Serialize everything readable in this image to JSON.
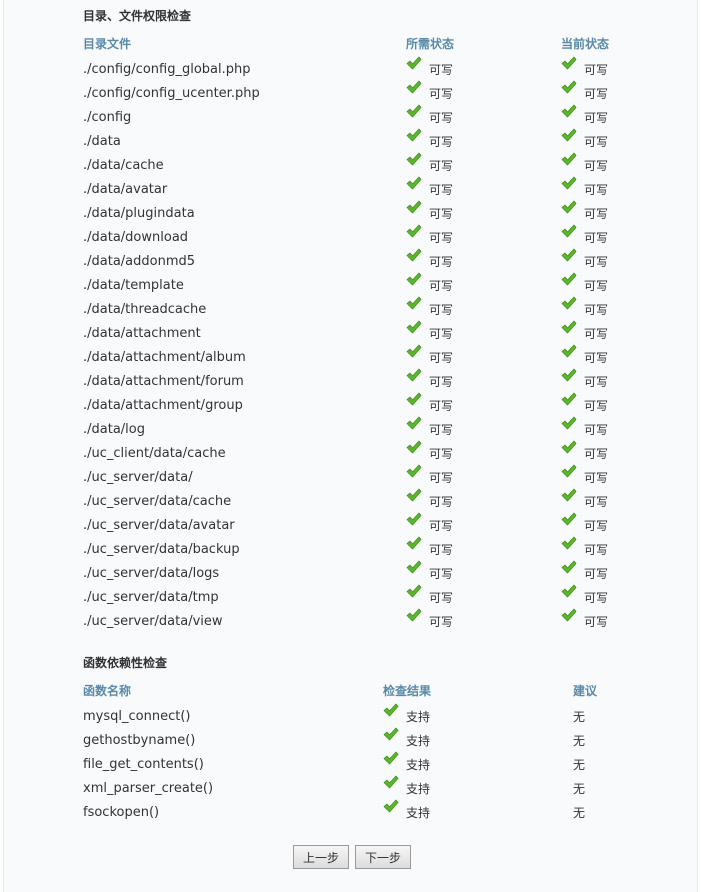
{
  "dir_check": {
    "title": "目录、文件权限检查",
    "headers": {
      "path": "目录文件",
      "required": "所需状态",
      "current": "当前状态"
    },
    "rows": [
      {
        "path": "./config/config_global.php",
        "required": "可写",
        "current": "可写"
      },
      {
        "path": "./config/config_ucenter.php",
        "required": "可写",
        "current": "可写"
      },
      {
        "path": "./config",
        "required": "可写",
        "current": "可写"
      },
      {
        "path": "./data",
        "required": "可写",
        "current": "可写"
      },
      {
        "path": "./data/cache",
        "required": "可写",
        "current": "可写"
      },
      {
        "path": "./data/avatar",
        "required": "可写",
        "current": "可写"
      },
      {
        "path": "./data/plugindata",
        "required": "可写",
        "current": "可写"
      },
      {
        "path": "./data/download",
        "required": "可写",
        "current": "可写"
      },
      {
        "path": "./data/addonmd5",
        "required": "可写",
        "current": "可写"
      },
      {
        "path": "./data/template",
        "required": "可写",
        "current": "可写"
      },
      {
        "path": "./data/threadcache",
        "required": "可写",
        "current": "可写"
      },
      {
        "path": "./data/attachment",
        "required": "可写",
        "current": "可写"
      },
      {
        "path": "./data/attachment/album",
        "required": "可写",
        "current": "可写"
      },
      {
        "path": "./data/attachment/forum",
        "required": "可写",
        "current": "可写"
      },
      {
        "path": "./data/attachment/group",
        "required": "可写",
        "current": "可写"
      },
      {
        "path": "./data/log",
        "required": "可写",
        "current": "可写"
      },
      {
        "path": "./uc_client/data/cache",
        "required": "可写",
        "current": "可写"
      },
      {
        "path": "./uc_server/data/",
        "required": "可写",
        "current": "可写"
      },
      {
        "path": "./uc_server/data/cache",
        "required": "可写",
        "current": "可写"
      },
      {
        "path": "./uc_server/data/avatar",
        "required": "可写",
        "current": "可写"
      },
      {
        "path": "./uc_server/data/backup",
        "required": "可写",
        "current": "可写"
      },
      {
        "path": "./uc_server/data/logs",
        "required": "可写",
        "current": "可写"
      },
      {
        "path": "./uc_server/data/tmp",
        "required": "可写",
        "current": "可写"
      },
      {
        "path": "./uc_server/data/view",
        "required": "可写",
        "current": "可写"
      }
    ]
  },
  "func_check": {
    "title": "函数依赖性检查",
    "headers": {
      "name": "函数名称",
      "result": "检查结果",
      "advice": "建议"
    },
    "rows": [
      {
        "name": "mysql_connect()",
        "result": "支持",
        "advice": "无"
      },
      {
        "name": "gethostbyname()",
        "result": "支持",
        "advice": "无"
      },
      {
        "name": "file_get_contents()",
        "result": "支持",
        "advice": "无"
      },
      {
        "name": "xml_parser_create()",
        "result": "支持",
        "advice": "无"
      },
      {
        "name": "fsockopen()",
        "result": "支持",
        "advice": "无"
      }
    ]
  },
  "buttons": {
    "prev": "上一步",
    "next": "下一步"
  },
  "icons": {
    "status_ok": "check-icon"
  },
  "colors": {
    "header_text": "#5a8aa8",
    "check_green": "#5cb82a",
    "panel_bg": "#f8fafc"
  }
}
